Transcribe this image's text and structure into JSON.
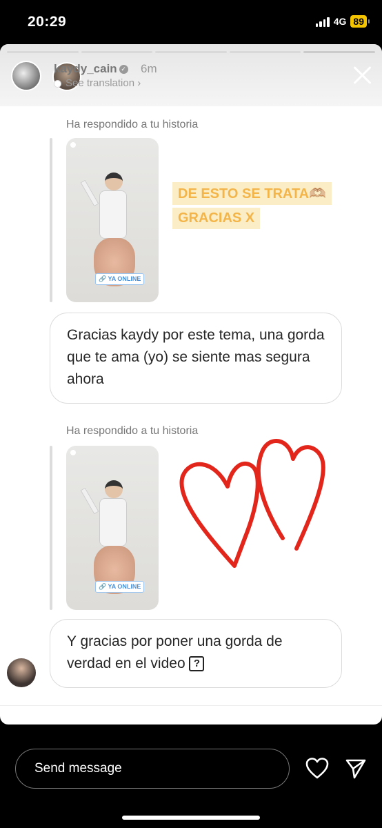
{
  "status_bar": {
    "time": "20:29",
    "network": "4G",
    "battery": "89"
  },
  "story": {
    "username": "kaydy_cain",
    "time_ago": "6m",
    "see_translation": "See translation"
  },
  "thread": [
    {
      "replied_label": "Ha respondido a tu historia",
      "thumbnail_badge": "🔗 YA ONLINE",
      "sticker_lines": [
        "DE ESTO SE TRATA🫶🏼",
        "GRACIAS X"
      ],
      "message": "Gracias kaydy por este tema, una gorda que te ama (yo) se siente mas segura ahora"
    },
    {
      "replied_label": "Ha respondido a tu historia",
      "thumbnail_badge": "🔗 YA ONLINE",
      "message": "Y gracias por poner una gorda de verdad en el video",
      "message_suffix": "?"
    }
  ],
  "composer": {
    "placeholder": "Send message"
  },
  "icons": {
    "heart": "heart-icon",
    "send": "send-icon",
    "close": "close-icon",
    "verified": "verified-badge-icon"
  },
  "colors": {
    "sticker_bg": "#fbeec6",
    "sticker_text": "#f3b54a",
    "heart_drawing": "#e3261c",
    "battery": "#f5c400"
  }
}
